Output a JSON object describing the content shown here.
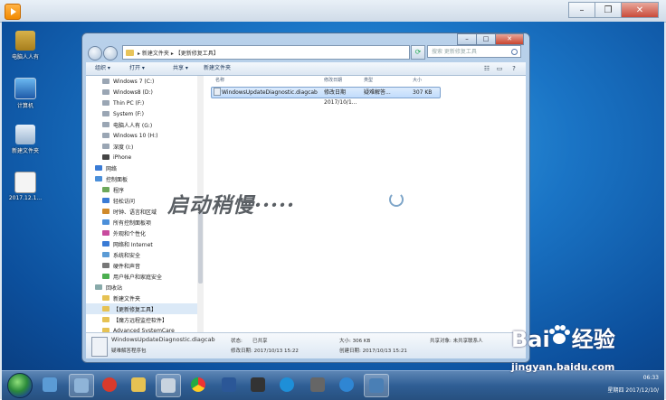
{
  "desktop_icons": [
    {
      "label": "电脑人人有",
      "top": 0
    },
    {
      "label": "计算机",
      "top": 0
    },
    {
      "label": "新建文件夹",
      "top": 0
    },
    {
      "label": "2017.12.1...",
      "top": 0
    }
  ],
  "explorer": {
    "breadcrumb": "▸ 新建文件夹 ▸ 【更新修复工具】",
    "search_placeholder": "搜索 更新修复工具",
    "toolbar": {
      "organize": "组织 ▾",
      "open": "打开 ▾",
      "share": "共享 ▾",
      "new_folder": "新建文件夹"
    },
    "nav_items": [
      "Windows 7  (C:)",
      "Windows8 (D:)",
      "Thin PC (F:)",
      "System (F:)",
      "电脑人人有 (G:)",
      "Windows 10 (H:)",
      "深度 (I:)",
      "iPhone",
      "网络",
      "控制面板",
      "程序",
      "轻松访问",
      "时钟、语言和区域",
      "所有控制面板项",
      "外观和个性化",
      "网络和 Internet",
      "系统和安全",
      "硬件和声音",
      "用户帐户和家庭安全",
      "回收站",
      "新建文件夹",
      "【更新修复工具】",
      "【魔方远程监控软件】",
      "Advanced SystemCare"
    ],
    "columns": {
      "name": "名称",
      "date": "修改日期",
      "type": "类型",
      "size": "大小"
    },
    "file": {
      "name": "WindowsUpdateDiagnostic.diagcab",
      "date": "修改日期 2017/10/1...",
      "type": "疑难解答...",
      "size": "307 KB"
    },
    "loading_text": "启动稍慢·····",
    "details": {
      "filename": "WindowsUpdateDiagnostic.diagcab",
      "type": "疑难解答程序包",
      "modified": "修改日期: 2017/10/13 15:22",
      "created": "创建日期: 2017/10/13 15:21",
      "state_label": "状态: ",
      "state_value": "已共享",
      "size": "大小: 306 KB",
      "share": "共享对象: 未共享联系人"
    }
  },
  "taskbar": {
    "time": "06:33",
    "date": "星期四 2017/12/10/"
  },
  "watermark": {
    "logo": "Bai  经验",
    "url": "jingyan.baidu.com"
  },
  "colors": {
    "desktop": "#1a74c5",
    "taskbar": "#2f5e95",
    "selection": "#c1dcfc"
  }
}
